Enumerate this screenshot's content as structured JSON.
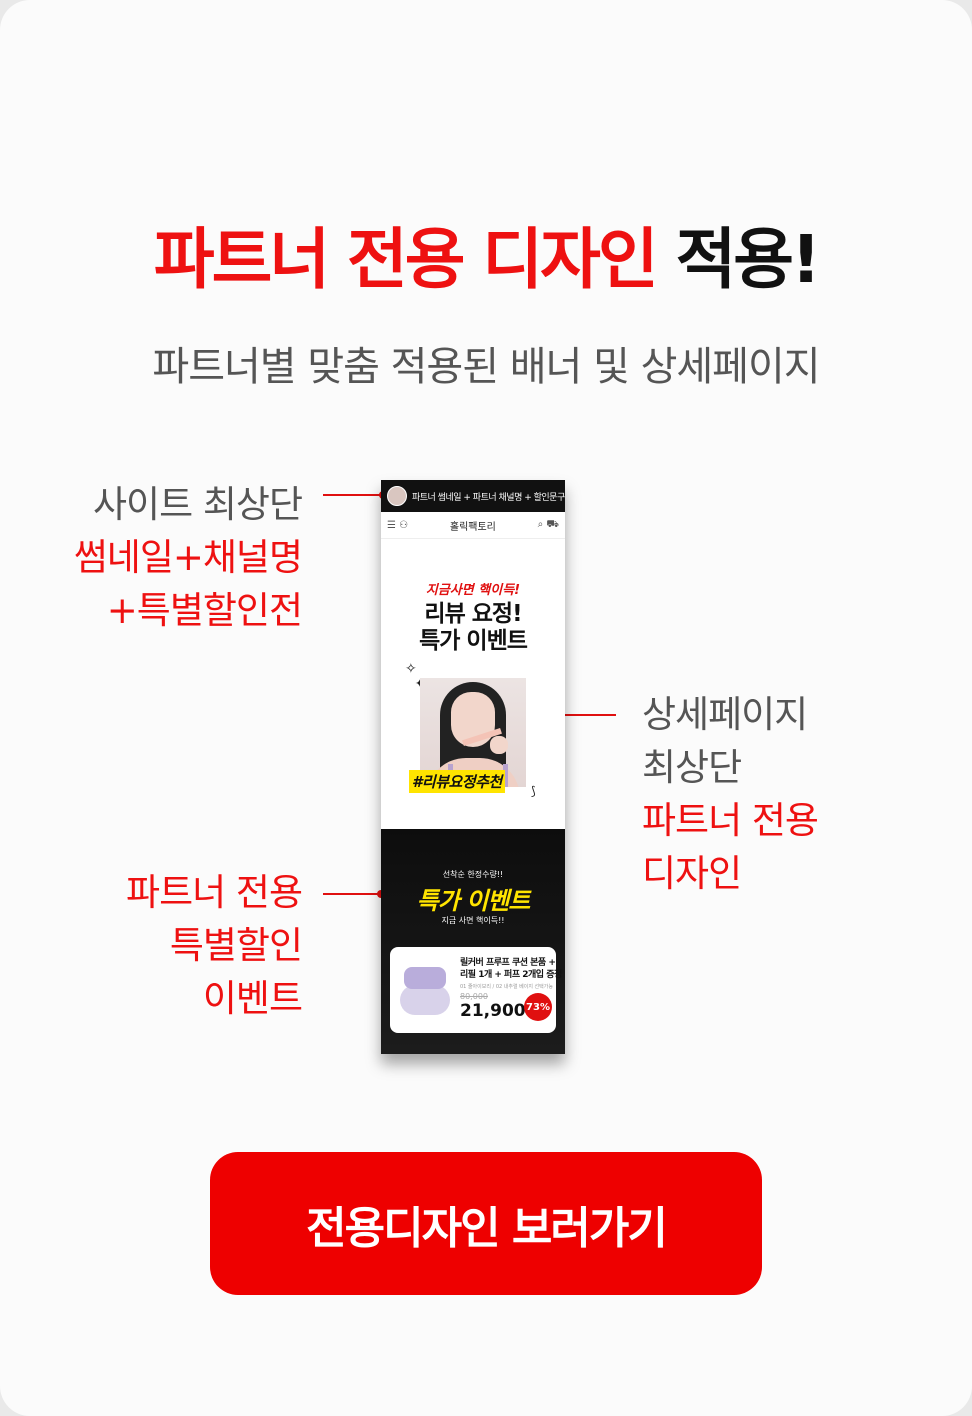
{
  "headline": {
    "red": "파트너 전용 디자인",
    "black": "적용!"
  },
  "subhead": "파트너별 맞춤 적용된 배너 및 상세페이지",
  "callouts": {
    "top_left": {
      "line1": "사이트 최상단",
      "line2": "썸네일+채널명",
      "line3": "+특별할인전"
    },
    "right": {
      "line1": "상세페이지",
      "line2": "최상단",
      "line3": "파트너 전용",
      "line4": "디자인"
    },
    "bottom_left": {
      "line1": "파트너 전용",
      "line2": "특별할인",
      "line3": "이벤트"
    }
  },
  "phone": {
    "top_bar": "파트너 썸네일 + 파트너 채널명 + 할인문구",
    "site_name": "홀릭팩토리",
    "tag": "지금사면 핵이득!",
    "title_line1": "리뷰 요정!",
    "title_line2": "특가 이벤트",
    "photo_label": "#리뷰요정추천",
    "event_small": "선착순 한정수량!!",
    "event_title": "특가 이벤트",
    "event_sub": "지금 사면 핵이득!!",
    "product": {
      "title_line1": "릴커버 프루프 쿠션 본품 +",
      "title_line2": "리필 1개 + 퍼프 2개입 증정",
      "option": "01 줄아이보리 / 02 내추럴 베이지 선택가능",
      "original_price": "80,000",
      "price": "21,900",
      "discount": "73%"
    }
  },
  "cta_label": "전용디자인 보러가기",
  "colors": {
    "accent": "#ee1111",
    "highlight": "#ffe400",
    "dark": "#111111"
  }
}
